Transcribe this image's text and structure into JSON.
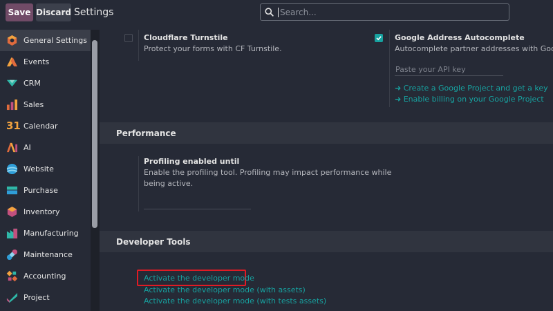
{
  "toolbar": {
    "save_label": "Save",
    "discard_label": "Discard",
    "title": "Settings"
  },
  "search": {
    "placeholder": "Search..."
  },
  "sidebar": {
    "items": [
      {
        "label": "General Settings",
        "icon": "general-settings-icon",
        "active": true
      },
      {
        "label": "Events",
        "icon": "events-icon"
      },
      {
        "label": "CRM",
        "icon": "crm-icon"
      },
      {
        "label": "Sales",
        "icon": "sales-icon"
      },
      {
        "label": "Calendar",
        "icon": "calendar-icon"
      },
      {
        "label": "AI",
        "icon": "ai-icon"
      },
      {
        "label": "Website",
        "icon": "website-icon"
      },
      {
        "label": "Purchase",
        "icon": "purchase-icon"
      },
      {
        "label": "Inventory",
        "icon": "inventory-icon"
      },
      {
        "label": "Manufacturing",
        "icon": "manufacturing-icon"
      },
      {
        "label": "Maintenance",
        "icon": "maintenance-icon"
      },
      {
        "label": "Accounting",
        "icon": "accounting-icon"
      },
      {
        "label": "Project",
        "icon": "project-icon"
      }
    ],
    "calendar_icon_text": "31"
  },
  "main": {
    "cloudflare": {
      "title": "Cloudflare Turnstile",
      "desc": "Protect your forms with CF Turnstile.",
      "checked": false
    },
    "google_address": {
      "title": "Google Address Autocomplete",
      "desc": "Autocomplete partner addresses with Google Pl",
      "checked": true,
      "api_placeholder": "Paste your API key",
      "link1": "➜ Create a Google Project and get a key",
      "link2": "➜ Enable billing on your Google Project"
    },
    "performance": {
      "header": "Performance",
      "title": "Profiling enabled until",
      "desc_line1": "Enable the profiling tool. Profiling may impact performance while",
      "desc_line2": "being active."
    },
    "developer_tools": {
      "header": "Developer Tools",
      "link1": "Activate the developer mode",
      "link2": "Activate the developer mode (with assets)",
      "link3": "Activate the developer mode (with tests assets)"
    }
  },
  "colors": {
    "accent": "#17a2a0",
    "brand": "#714b67",
    "highlight": "#e01b24",
    "background": "#262a36"
  }
}
